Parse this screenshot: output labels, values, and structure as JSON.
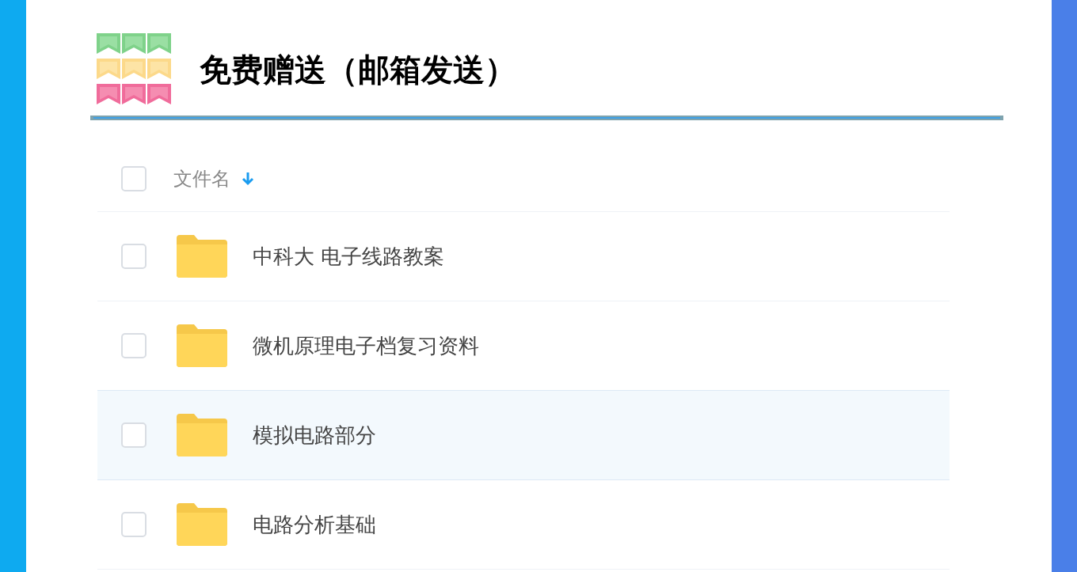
{
  "title": "免费赠送（邮箱发送）",
  "table": {
    "select_all": {
      "checked": false
    },
    "column": {
      "label": "文件名",
      "sort_descending": true
    },
    "rows": [
      {
        "name": "中科大 电子线路教案",
        "checked": false,
        "highlighted": false
      },
      {
        "name": "微机原理电子档复习资料",
        "checked": false,
        "highlighted": false
      },
      {
        "name": "模拟电路部分",
        "checked": false,
        "highlighted": true
      },
      {
        "name": "电路分析基础",
        "checked": false,
        "highlighted": false
      }
    ]
  }
}
